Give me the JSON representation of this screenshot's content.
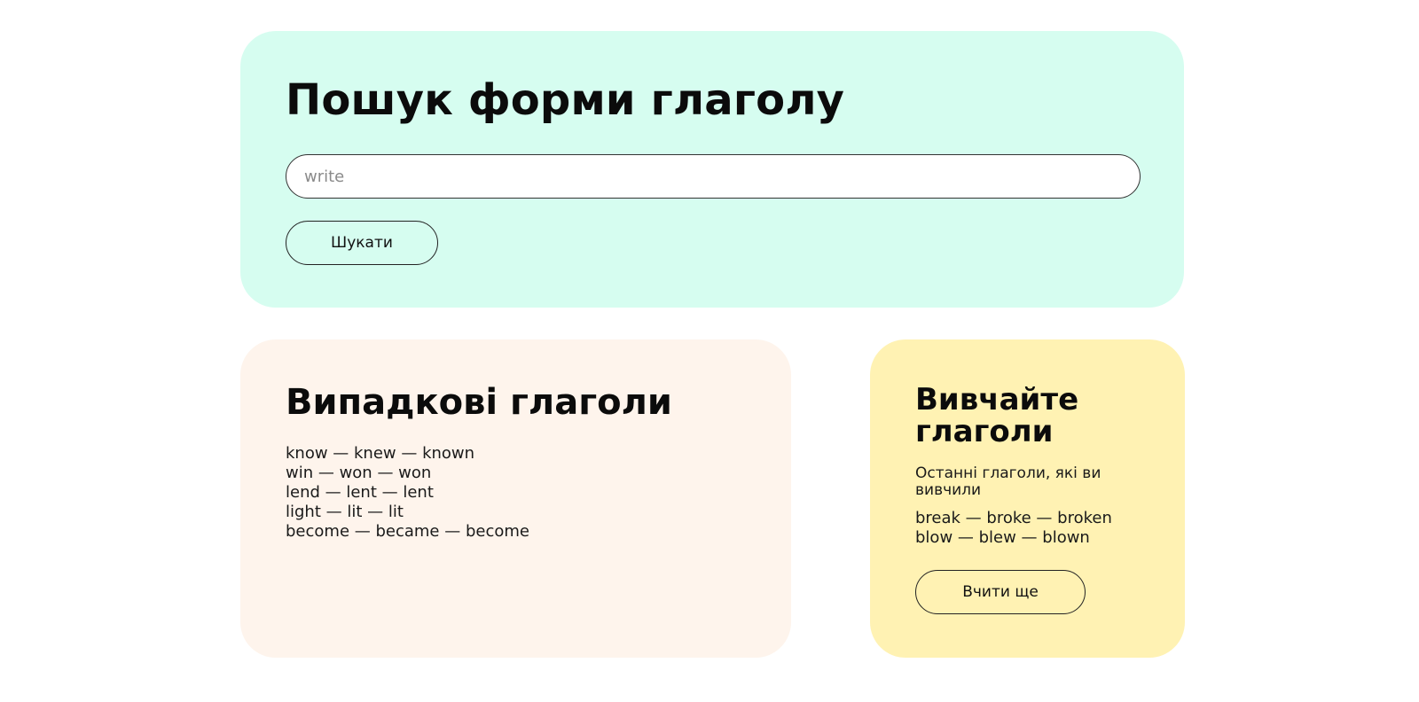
{
  "search": {
    "title": "Пошук форми глаголу",
    "placeholder": "write",
    "button_label": "Шукати"
  },
  "random": {
    "title": "Випадкові глаголи",
    "verbs": [
      "know — knew — known",
      "win — won — won",
      "lend — lent — lent",
      "light — lit — lit",
      "become — became — become"
    ]
  },
  "learn": {
    "title": "Вивчайте глаголи",
    "subtitle": "Останні глаголи, які ви вивчили",
    "verbs": [
      "break — broke — broken",
      "blow — blew — blown"
    ],
    "button_label": "Вчити ще"
  },
  "colors": {
    "search_card_bg": "#d6fdf0",
    "random_card_bg": "#fef4ec",
    "learn_card_bg": "#fff2b3",
    "border": "#222222"
  }
}
